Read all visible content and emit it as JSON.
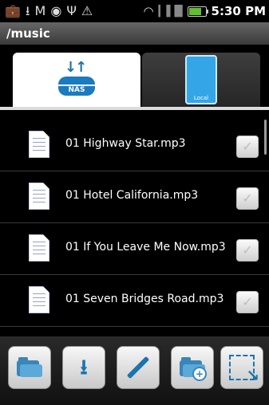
{
  "status_bar": {
    "time": "5:30 PM",
    "icons": [
      "briefcase-icon",
      "download-icon",
      "gmail-icon",
      "location-icon",
      "usb-icon",
      "warning-icon",
      "wifi-icon",
      "signal-icon",
      "battery-icon"
    ]
  },
  "path": {
    "title": "/music"
  },
  "tabs": [
    {
      "id": "nas",
      "label": "NAS",
      "selected": true
    },
    {
      "id": "local",
      "label": "Local",
      "selected": false
    }
  ],
  "files": [
    {
      "name": "01 Highway Star.mp3",
      "checked": false
    },
    {
      "name": "01 Hotel California.mp3",
      "checked": false
    },
    {
      "name": "01 If You Leave Me Now.mp3",
      "checked": false
    },
    {
      "name": "01 Seven Bridges Road.mp3",
      "checked": false
    }
  ],
  "toolbar": {
    "buttons": [
      {
        "name": "open-folder-button",
        "icon": "folder-open-icon"
      },
      {
        "name": "download-button",
        "icon": "download-icon"
      },
      {
        "name": "rename-button",
        "icon": "pencil-icon"
      },
      {
        "name": "new-folder-button",
        "icon": "folder-add-icon"
      },
      {
        "name": "select-button",
        "icon": "select-icon"
      }
    ]
  },
  "colors": {
    "accent": "#1c74ad",
    "tab_active": "#ffffff",
    "background": "#000000"
  }
}
